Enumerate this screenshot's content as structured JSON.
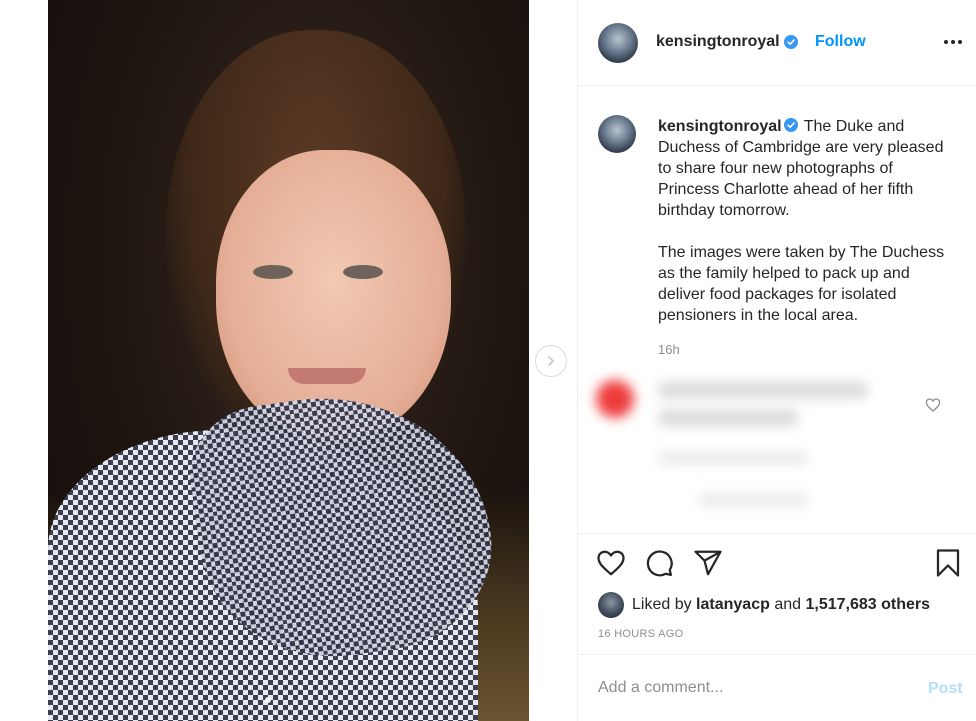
{
  "post": {
    "username": "kensingtonroyal",
    "follow_label": "Follow",
    "caption_p1": "The Duke and Duchess of Cambridge are very pleased to share four new photographs of Princess Charlotte ahead of her fifth birthday tomorrow.",
    "caption_p2": "The images were taken by The Duchess as the family helped to pack up and deliver food packages for isolated pensioners in the local area.",
    "caption_time": "16h",
    "liked_by_prefix": "Liked by",
    "liked_by_user": "latanyacp",
    "liked_by_and": "and",
    "liked_count": "1,517,683 others",
    "timestamp": "16 HOURS AGO",
    "comment_placeholder": "Add a comment...",
    "post_label": "Post"
  },
  "colors": {
    "accent": "#0095f6",
    "post_disabled": "#b2dffc",
    "muted": "#8e8e8e",
    "text": "#262626"
  },
  "icons": {
    "header": [
      "avatar",
      "verified-badge-icon",
      "more-options-icon"
    ],
    "actions": [
      "heart-icon",
      "comment-icon",
      "share-icon",
      "bookmark-icon"
    ],
    "photo": [
      "chevron-right-icon"
    ]
  }
}
